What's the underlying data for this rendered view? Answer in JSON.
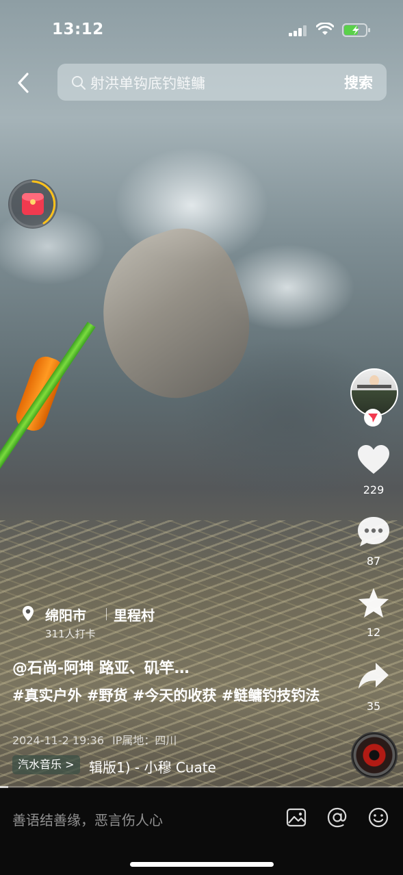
{
  "status_bar": {
    "time": "13:12",
    "battery": "charging"
  },
  "search": {
    "query": "射洪单钩底钓鲢鳙",
    "submit_label": "搜索"
  },
  "rail": {
    "likes": "229",
    "comments": "87",
    "favorites": "12",
    "shares": "35"
  },
  "post": {
    "location": {
      "city": "绵阳市",
      "village": "里程村",
      "checkins": "311人打卡"
    },
    "author_line": "@石尚-阿坤  路亚、矶竿…",
    "tags": "#真实户外 #野货 #今天的收获 #鲢鳙钓技钓法",
    "date": "2024-11-2 19:36",
    "ip": "IP属地：四川",
    "music_tag": "汽水音乐",
    "music_title": "辑版1) - 小穆   Cuate",
    "progress": 0.02
  },
  "comment_bar": {
    "placeholder": "善语结善缘，恶言伤人心"
  },
  "colors": {
    "accent": "#f23a4f",
    "like": "#ffffff",
    "comment_bar_bg": "#0b0b0b"
  },
  "icons": [
    "back-icon",
    "search-icon",
    "red-packet-icon",
    "heart-icon",
    "comment-icon",
    "star-icon",
    "share-icon",
    "image-icon",
    "at-icon",
    "emoji-icon",
    "location-pin-icon"
  ]
}
